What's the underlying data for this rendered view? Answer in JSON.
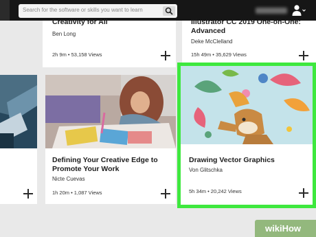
{
  "search": {
    "placeholder": "Search for the software or skills you want to learn"
  },
  "header_user": {
    "name_blurred": true
  },
  "top_cards": [
    {
      "title": "Creativity for All",
      "author": "Ben Long",
      "meta": "2h 9m  •  53,158 Views"
    },
    {
      "title_line1": "Illustrator CC 2019 One-on-One:",
      "title_line2": "Advanced",
      "author": "Deke McClelland",
      "meta": "15h 49m  •  35,629 Views"
    }
  ],
  "cards": [
    {
      "title_line1": "Defining Your Creative Edge to",
      "title_line2": "Promote Your Work",
      "author": "Nicte Cuevas",
      "meta": "1h 20m  •  1,087 Views"
    },
    {
      "title": "Drawing Vector Graphics",
      "author": "Von Glitschka",
      "meta": "5h 34m  •  20,242 Views"
    }
  ],
  "watermark": {
    "wiki": "wiki",
    "how": "How"
  },
  "colors": {
    "highlight": "#3ee83e",
    "topbar": "#161616",
    "watermark": "#93b87d"
  },
  "icons": [
    "search-icon",
    "user-icon",
    "chevron-down-icon",
    "add-icon"
  ]
}
